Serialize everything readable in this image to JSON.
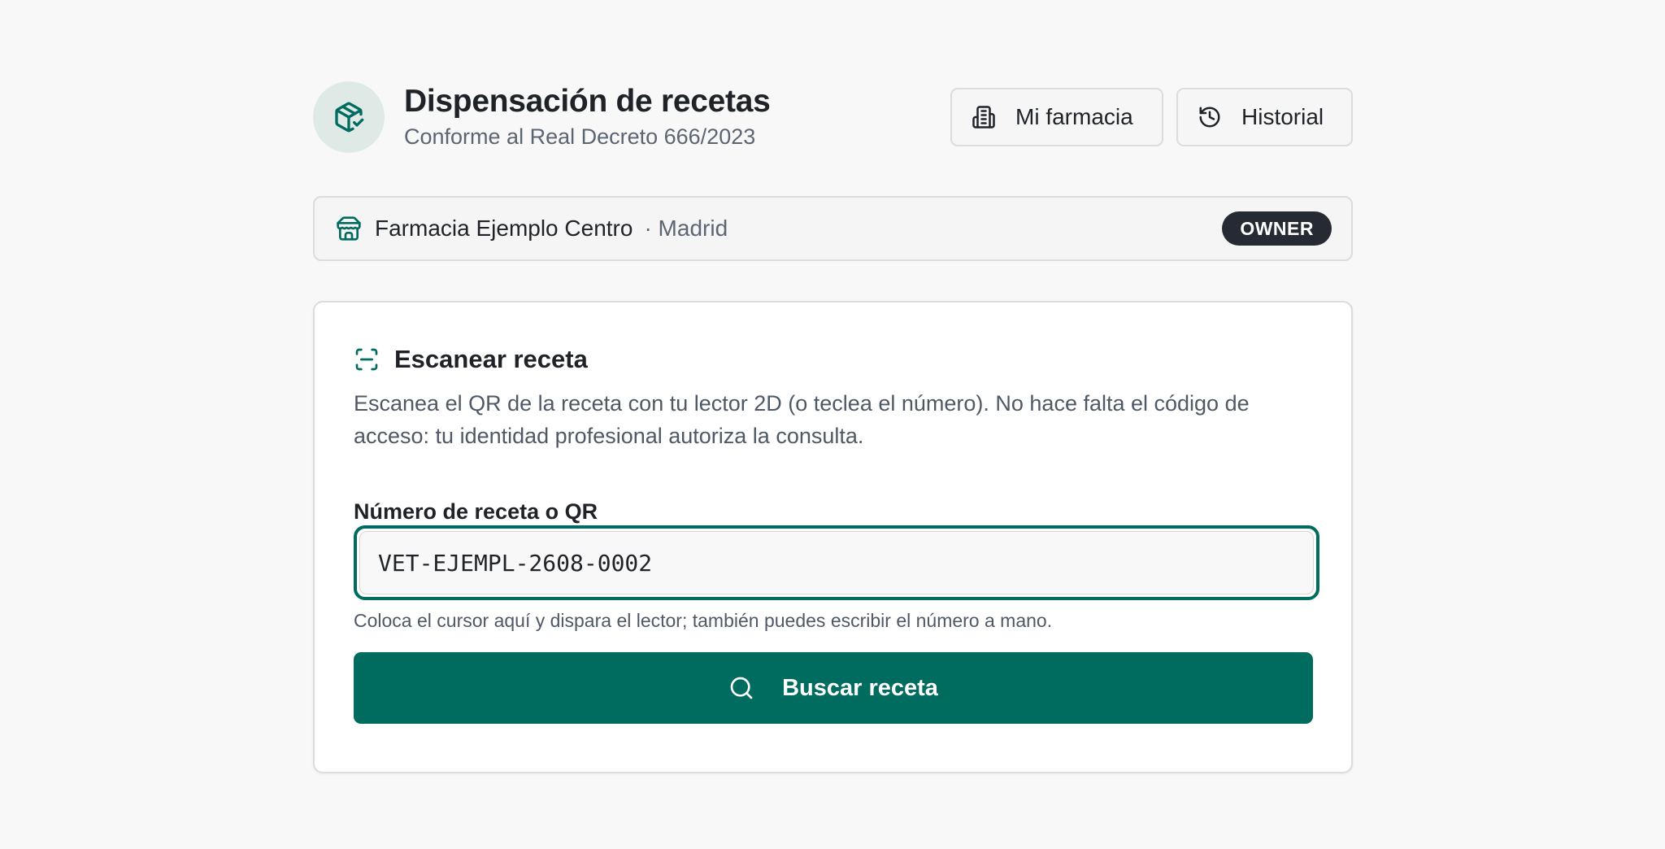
{
  "header": {
    "title": "Dispensación de recetas",
    "subtitle": "Conforme al Real Decreto 666/2023",
    "actions": {
      "my_pharmacy_label": "Mi farmacia",
      "history_label": "Historial"
    }
  },
  "pharmacy": {
    "name": "Farmacia Ejemplo Centro",
    "city": "· Madrid",
    "role": "OWNER"
  },
  "scan_card": {
    "title": "Escanear receta",
    "description": "Escanea el QR de la receta con tu lector 2D (o teclea el número). No hace falta el código de acceso: tu identidad profesional autoriza la consulta.",
    "field_label": "Número de receta o QR",
    "field_value": "VET-EJEMPL-2608-0002",
    "field_hint": "Coloca el cursor aquí y dispara el lector; también puedes escribir el número a mano.",
    "submit_label": "Buscar receta"
  },
  "icons": {
    "logo": "package-check-icon",
    "my_pharmacy": "building-icon",
    "history": "history-icon",
    "pharmacy": "store-icon",
    "scan": "scan-line-icon",
    "search": "search-icon"
  },
  "colors": {
    "accent": "#006b5f",
    "logo_bg": "#dfeae7",
    "badge_bg": "#262b33",
    "background": "#f8f8f8"
  }
}
